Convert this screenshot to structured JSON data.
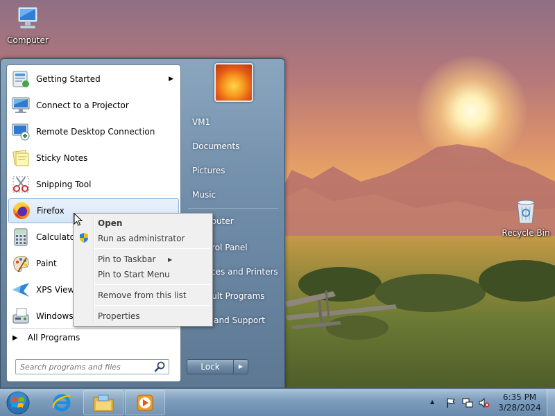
{
  "desktop": {
    "icons": [
      {
        "label": "Computer"
      },
      {
        "label": "Recycle Bin"
      }
    ]
  },
  "start_menu": {
    "programs": [
      {
        "label": "Getting Started",
        "icon": "getting-started-icon",
        "has_submenu": true
      },
      {
        "label": "Connect to a Projector",
        "icon": "projector-icon"
      },
      {
        "label": "Remote Desktop Connection",
        "icon": "remote-desktop-icon"
      },
      {
        "label": "Sticky Notes",
        "icon": "sticky-notes-icon"
      },
      {
        "label": "Snipping Tool",
        "icon": "snipping-tool-icon"
      },
      {
        "label": "Firefox",
        "icon": "firefox-icon",
        "highlighted": true
      },
      {
        "label": "Calculator",
        "icon": "calculator-icon"
      },
      {
        "label": "Paint",
        "icon": "paint-icon"
      },
      {
        "label": "XPS Viewer",
        "icon": "xps-viewer-icon"
      },
      {
        "label": "Windows Fax and Scan",
        "icon": "fax-scan-icon"
      }
    ],
    "all_programs": "All Programs",
    "search_placeholder": "Search programs and files",
    "places": [
      "VM1",
      "Documents",
      "Pictures",
      "Music",
      "Computer",
      "Control Panel",
      "Devices and Printers",
      "Default Programs",
      "Help and Support"
    ],
    "lock_label": "Lock"
  },
  "context_menu": {
    "items": [
      "Open",
      "Run as administrator",
      "Pin to Taskbar",
      "Pin to Start Menu",
      "Remove from this list",
      "Properties"
    ]
  },
  "taskbar": {
    "pinned": [
      "internet-explorer-icon",
      "file-explorer-icon",
      "media-player-icon"
    ],
    "clock_time": "6:35 PM",
    "clock_date": "3/28/2024"
  },
  "colors": {
    "taskbar": "#7f9fbe",
    "start_menu": "#6f8ca8",
    "highlight": "#d4e6f9"
  }
}
